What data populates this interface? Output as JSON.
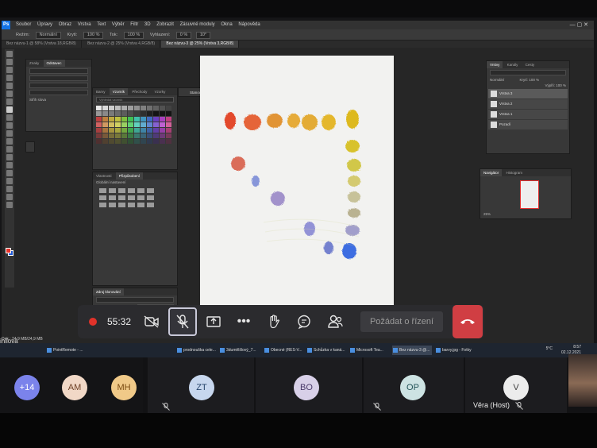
{
  "photoshop": {
    "menu": [
      "Soubor",
      "Úpravy",
      "Obraz",
      "Vrstva",
      "Text",
      "Výběr",
      "Filtr",
      "3D",
      "Zobrazit",
      "Zásuvné moduly",
      "Okna",
      "Nápověda"
    ],
    "options": [
      "Režim:",
      "Normální",
      "Krytí:",
      "100 %",
      "Tok:",
      "100 %",
      "Vyhlazení:",
      "0 %",
      "10°"
    ],
    "tabs": [
      "Bez názvu-1 @ 58% (Vrstva 18,RGB/8)",
      "Bez názvu-2 @ 25% (Vrstva 4,RGB/8)",
      "Bez názvu-3 @ 25% (Vrstva 3,RGB/8)"
    ],
    "panel_char": {
      "tabs": [
        "Znaky",
        "Odstavec"
      ],
      "label": "Střih slova"
    },
    "panel_swatches": {
      "tabs": [
        "Barvy",
        "Vzorník",
        "Přechody",
        "Vzorky"
      ],
      "search": "Vyhledat vzorník"
    },
    "panel_brushes": {
      "tabs": [
        "Vlastnosti",
        "Přizpůsobení"
      ],
      "label": "Globální nastavení"
    },
    "panel_history": {
      "tabs": [
        "Zdroj klonování"
      ]
    },
    "panel_layers": {
      "tabs": [
        "Vrstvy",
        "Kanály",
        "Cesty"
      ],
      "mode": "Normální",
      "opacity_label": "Krytí:",
      "opacity": "100 %",
      "fill_label": "Výplň:",
      "fill": "100 %",
      "layers": [
        "Vrstva 3",
        "Vrstva 2",
        "Vrstva 1",
        "Pozadí"
      ]
    },
    "panel_navigator": {
      "tabs": [
        "Navigátor",
        "Histogram"
      ],
      "zoom": "25%"
    },
    "floating_button": "Stanovy",
    "status": "Dok.: 24,9 MB/24,9 MB",
    "zoom_value": "100,0 %"
  },
  "meeting": {
    "timer": "55:32",
    "request_control": "Požádat o řízení",
    "colors": {
      "hangup": "#d03e43",
      "record": "#e0322a",
      "accent": "#7b83eb"
    }
  },
  "taskbar": {
    "items": [
      "PointRemote - ...",
      "prodnouška cele...",
      "3dumělšlový_7...",
      "Obecné (RES-V...",
      "Schůzka v kaná...",
      "Microsoft Tea...",
      "Bez názvu-3 @...",
      "barvy.jpg - Fotky"
    ],
    "temperature": "5°C",
    "time": "8:57",
    "date": "02.12.2021"
  },
  "partial_name": "ihilová",
  "participants": [
    {
      "initials": "+14"
    },
    {
      "initials": "AM"
    },
    {
      "initials": "MH"
    },
    {
      "initials": "ZT"
    },
    {
      "initials": "BO"
    },
    {
      "initials": "OP"
    },
    {
      "initials": "V"
    }
  ],
  "host_label": "Věra (Host)"
}
